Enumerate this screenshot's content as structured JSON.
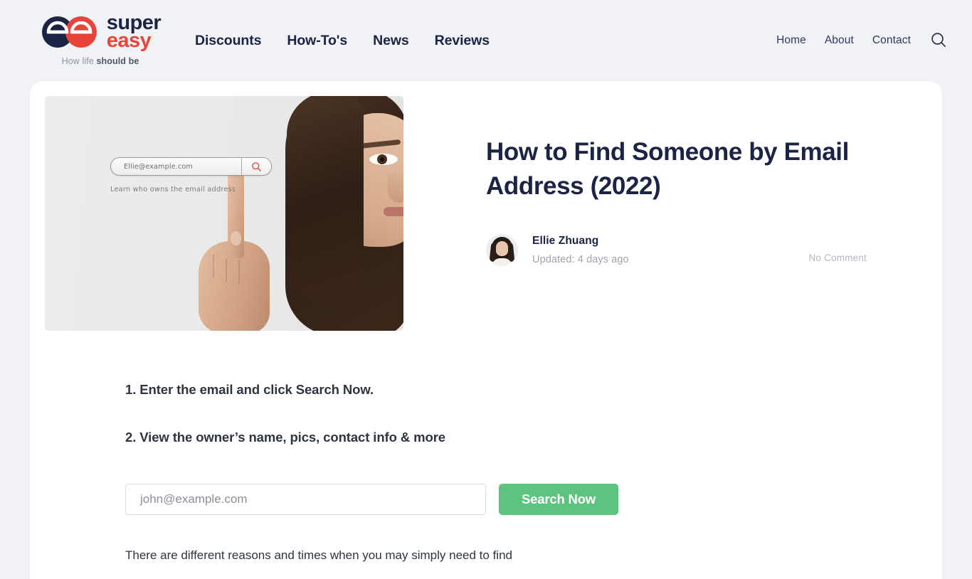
{
  "brand": {
    "name_line1": "super",
    "name_line2": "easy",
    "tagline_light": "How life ",
    "tagline_bold": "should be",
    "navy": "#1b2444",
    "red": "#e8443a"
  },
  "nav": {
    "primary": [
      {
        "label": "Discounts"
      },
      {
        "label": "How-To's"
      },
      {
        "label": "News"
      },
      {
        "label": "Reviews"
      }
    ],
    "utility": [
      {
        "label": "Home"
      },
      {
        "label": "About"
      },
      {
        "label": "Contact"
      }
    ],
    "search_icon": "search-icon"
  },
  "hero_image": {
    "search_value": "Ellie@example.com",
    "caption": "Learn who owns the email address",
    "search_icon": "magnifier-icon"
  },
  "article": {
    "title": "How to Find Someone by Email Address (2022)",
    "author": "Ellie Zhuang",
    "updated": "Updated: 4 days ago",
    "comments": "No Comment"
  },
  "steps": [
    {
      "text": "1. Enter the email and click Search Now."
    },
    {
      "text": "2. View the owner’s name, pics, contact info & more"
    }
  ],
  "search_form": {
    "placeholder": "john@example.com",
    "value": "",
    "button_label": "Search Now",
    "button_color": "#5cc380"
  },
  "content": {
    "first_paragraph": "There are different reasons and times when you may simply need to find"
  }
}
